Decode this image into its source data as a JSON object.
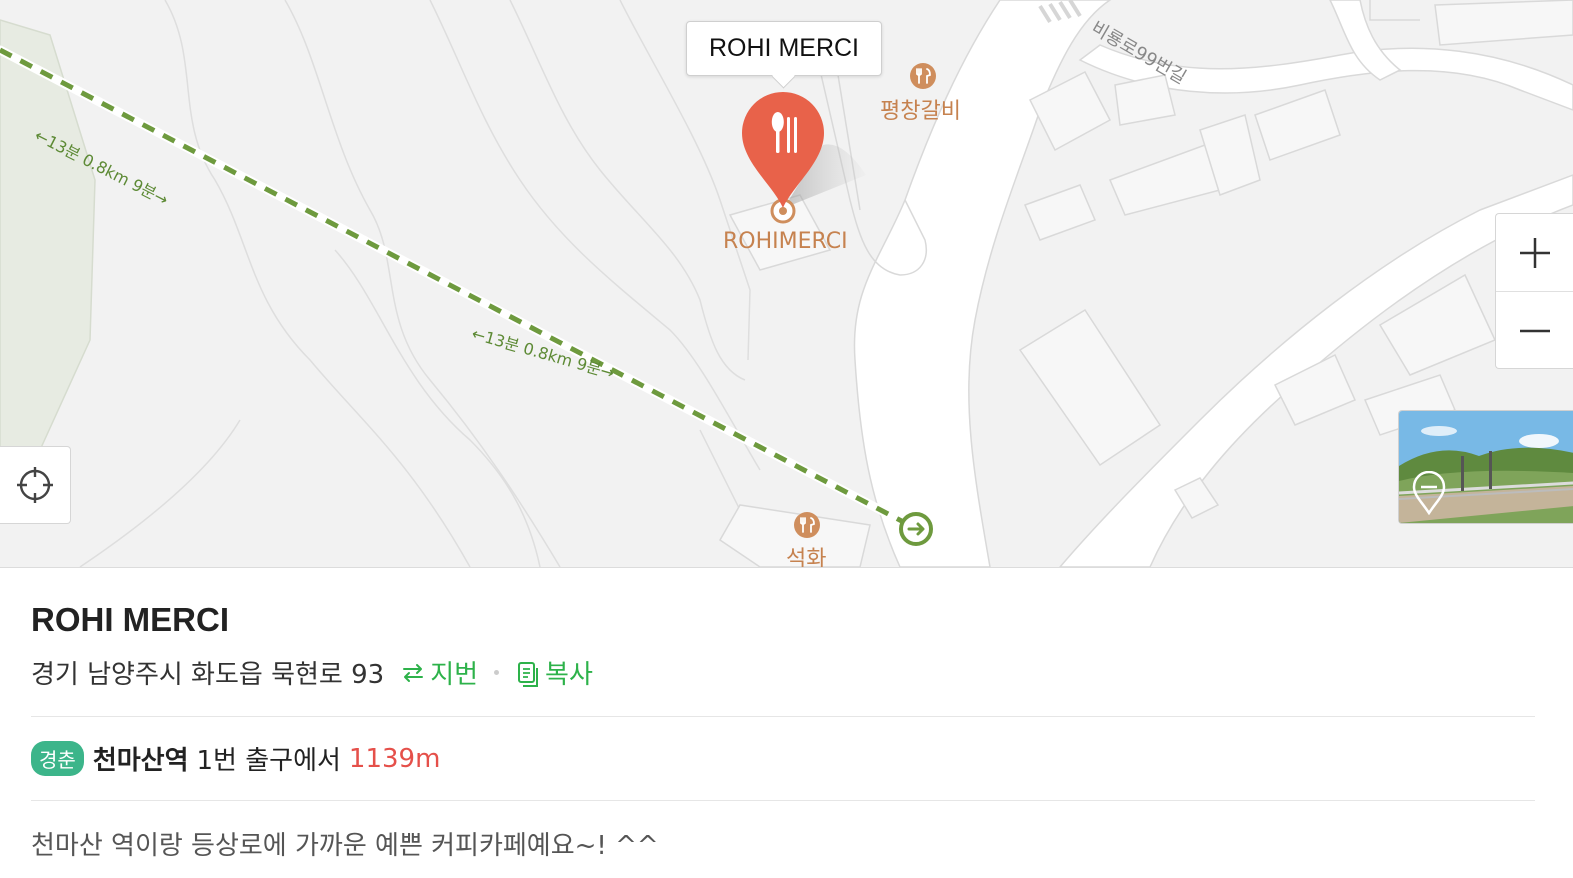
{
  "map": {
    "callout_title": "ROHI MERCI",
    "marker_label": "ROHIMERCI",
    "poi_1": "평창갈비",
    "poi_2": "석화",
    "road_name": "비룡로99번길",
    "route_label_1": "←13분 0.8km 9분→",
    "route_label_2": "←13분 0.8km 9분→",
    "colors": {
      "marker": "#e8624a",
      "route": "#6e9a3e",
      "poi": "#c6824f"
    },
    "icons": [
      "restaurant-icon",
      "zoom-in-icon",
      "zoom-out-icon",
      "locate-icon",
      "streetview-icon",
      "route-end-icon"
    ]
  },
  "place": {
    "name": "ROHI MERCI",
    "address": "경기 남양주시 화도읍 묵현로 93",
    "jibun_label": "지번",
    "copy_label": "복사",
    "subway_line": "경춘",
    "station": "천마산역",
    "exit_text": "1번 출구에서",
    "distance": "1139m",
    "description": "천마산 역이랑 등상로에 가까운 예쁜 커피카페예요~! ^^"
  }
}
